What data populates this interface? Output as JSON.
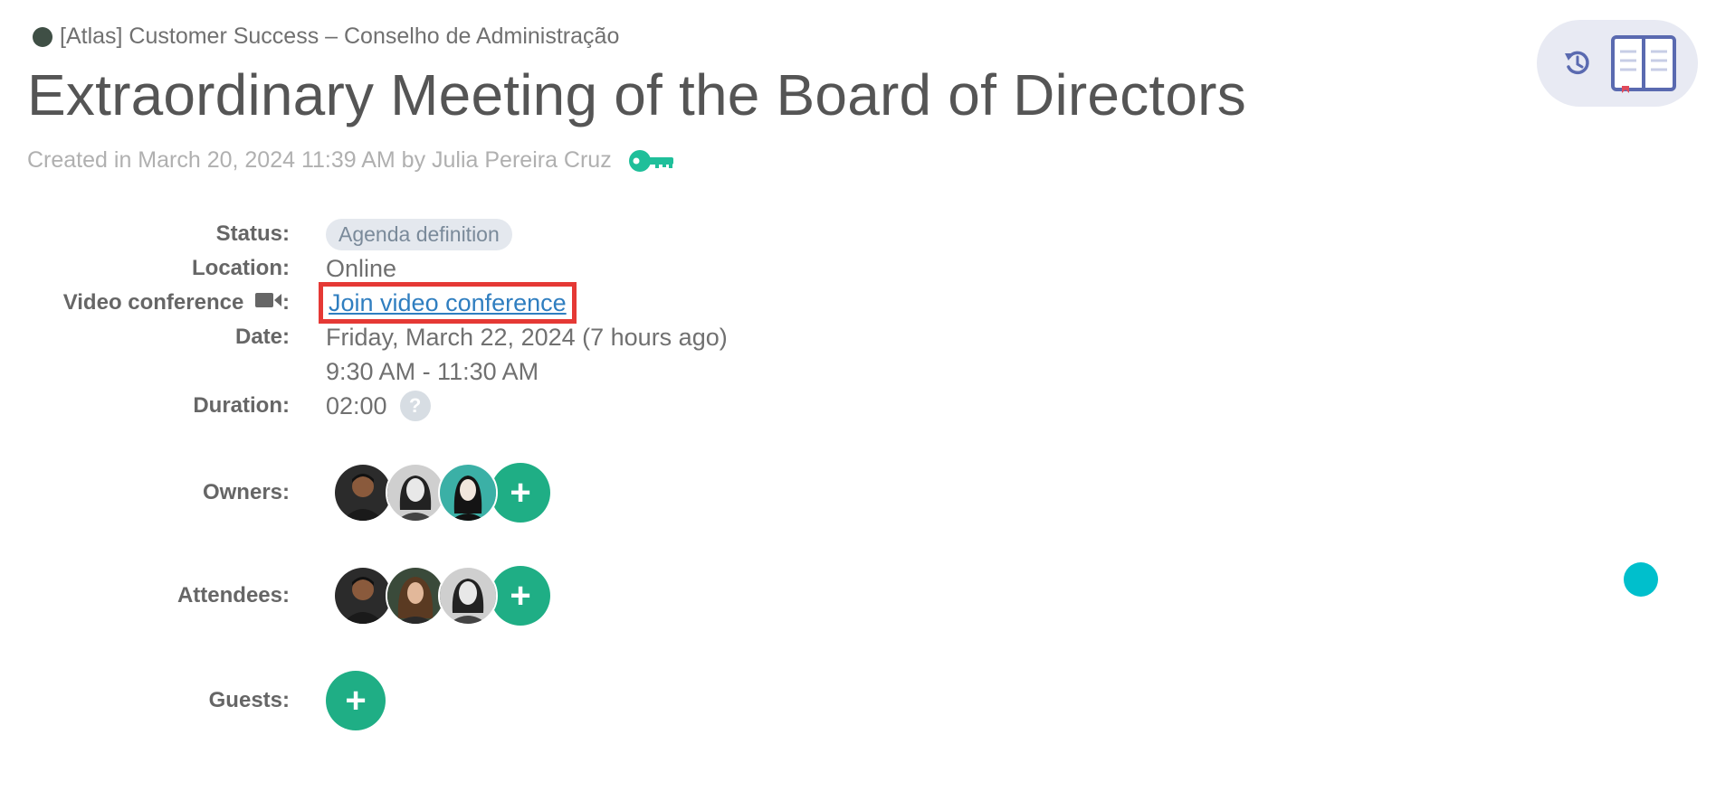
{
  "header": {
    "breadcrumb": "[Atlas] Customer Success – Conselho de Administração",
    "title": "Extraordinary Meeting of the Board of Directors",
    "created": "Created in March 20, 2024 11:39 AM by Julia Pereira Cruz"
  },
  "details": {
    "status_label": "Status:",
    "status_value": "Agenda definition",
    "location_label": "Location:",
    "location_value": "Online",
    "video_label": "Video conference",
    "video_colon": ":",
    "video_link": "Join video conference",
    "date_label": "Date:",
    "date_value": "Friday, March 22, 2024  (7 hours ago)",
    "time_value": "9:30 AM - 11:30 AM",
    "duration_label": "Duration:",
    "duration_value": "02:00",
    "help_glyph": "?",
    "owners_label": "Owners:",
    "attendees_label": "Attendees:",
    "guests_label": "Guests:",
    "add_glyph": "+"
  },
  "colors": {
    "accent_green": "#1fae85",
    "link_blue": "#2f7ec0",
    "highlight_red": "#e53935",
    "teal_dot": "#00bfcc",
    "key_teal": "#1fbf9a"
  },
  "icons": {
    "history": "history-icon",
    "book": "book-icon",
    "key": "key-icon",
    "camera": "video-camera-icon"
  }
}
